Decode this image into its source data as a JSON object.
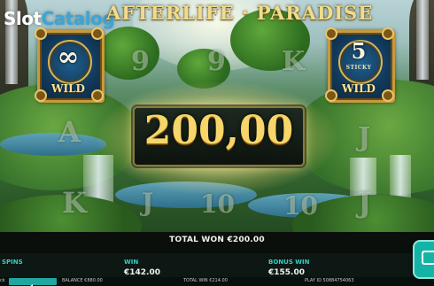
{
  "header": {
    "site_logo_part1": "Slot",
    "site_logo_part2": "Catalog",
    "game_title": "AFTERLIFE · PARADISE"
  },
  "reels": {
    "wild_left": {
      "big": "∞",
      "sticky": "STICKY",
      "label": "WILD"
    },
    "wild_right": {
      "big": "5",
      "sticky": "STICKY",
      "label": "WILD"
    },
    "ghost_symbols": [
      "9",
      "9",
      "K",
      "A",
      "A",
      "J",
      "K",
      "J",
      "10",
      "10",
      "J",
      "9"
    ]
  },
  "win": {
    "amount": "200,00"
  },
  "bottom": {
    "total_won": "TOTAL WON €200.00",
    "spins_label": "SPINS",
    "win_label": "WIN",
    "win_value": "€142.00",
    "bonus_win_label": "BONUS WIN",
    "bonus_win_value": "€155.00"
  },
  "status": {
    "balance": "BALANCE €880.00",
    "total_win": "TOTAL WIN €214.00",
    "play_id": "PLAY ID 50884754063",
    "left_glyph": "ck"
  },
  "icons": {
    "chat": "chat-icon",
    "sound": "sound-icon"
  },
  "colors": {
    "accent": "#34d1c2",
    "gold": "#f6d66a",
    "logo_blue": "#3aa5d8"
  }
}
